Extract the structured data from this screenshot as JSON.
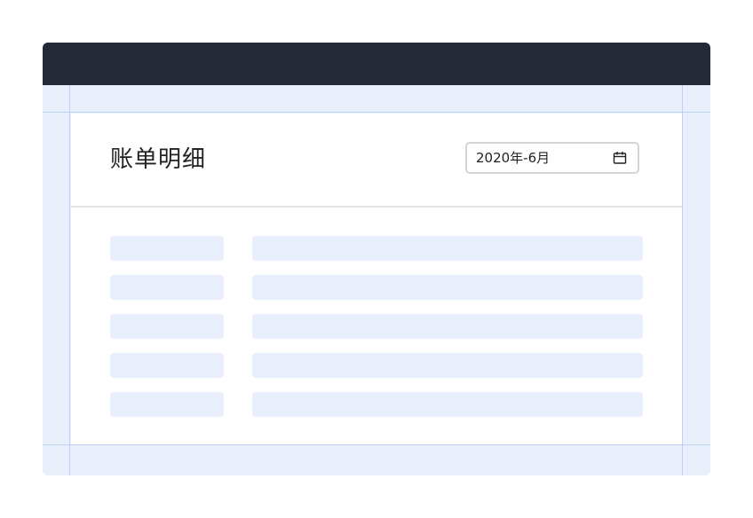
{
  "header": {
    "title": "账单明细"
  },
  "date_picker": {
    "value": "2020年-6月",
    "icon": "calendar-icon"
  },
  "skeleton_rows": 5,
  "colors": {
    "titlebar": "#232936",
    "guide_background": "#e8effa",
    "guide_line": "#b9d2f3",
    "skeleton": "#e8effa",
    "panel": "#ffffff"
  }
}
